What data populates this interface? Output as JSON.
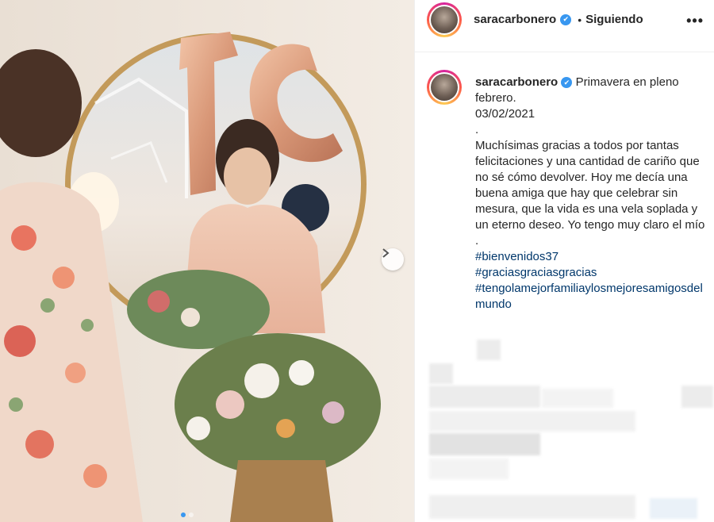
{
  "post": {
    "username": "saracarbonero",
    "verified_badge": "✔",
    "follow_separator": "•",
    "follow_label": "Siguiendo",
    "more_options": "•••",
    "next_icon": "chevron-right-icon",
    "caption": {
      "title": "Primavera en pleno febrero.",
      "date": "03/02/2021",
      "separator1": ".",
      "body": "Muchísimas gracias a todos por tantas felicitaciones y una cantidad de cariño que no sé cómo devolver. Hoy me decía una buena amiga que hay que celebrar sin mesura, que la vida es una vela soplada y un eterno deseo. Yo tengo muy claro el mío",
      "separator2": ".",
      "hashtags": [
        "#bienvenidos37",
        "#graciasgraciasgracias",
        "#tengolamejorfamiliaylosmejoresamigosdelmundo"
      ]
    }
  },
  "colors": {
    "hashtag": "#00376b",
    "verified": "#3897f0",
    "text": "#262626",
    "story_ring": "#d6249f"
  }
}
